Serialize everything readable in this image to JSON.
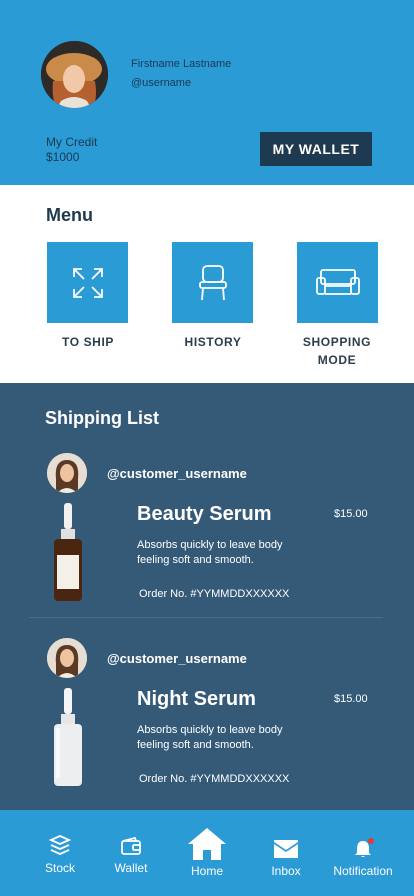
{
  "profile": {
    "name": "Firstname Lastname",
    "handle": "@username",
    "credit_label": "My Credit",
    "credit_value": "$1000",
    "wallet_button": "MY WALLET"
  },
  "menu": {
    "title": "Menu",
    "items": [
      {
        "label": "TO SHIP",
        "icon": "expand-arrows-icon"
      },
      {
        "label": "HISTORY",
        "icon": "chair-icon"
      },
      {
        "label": "SHOPPING",
        "label2": "MODE",
        "icon": "sofa-icon"
      }
    ]
  },
  "shipping": {
    "title": "Shipping List",
    "orders": [
      {
        "customer": "@customer_username",
        "product": "Beauty Serum",
        "price": "$15.00",
        "description": "Absorbs quickly to leave body feeling soft and smooth.",
        "order_no": "Order No. #YYMMDDXXXXXX"
      },
      {
        "customer": "@customer_username",
        "product": "Night Serum",
        "price": "$15.00",
        "description": "Absorbs quickly to leave body feeling soft and smooth.",
        "order_no": "Order No. #YYMMDDXXXXXX"
      }
    ]
  },
  "nav": {
    "items": [
      {
        "label": "Stock",
        "icon": "layers-icon"
      },
      {
        "label": "Wallet",
        "icon": "wallet-icon"
      },
      {
        "label": "Home",
        "icon": "home-icon"
      },
      {
        "label": "Inbox",
        "icon": "envelope-icon"
      },
      {
        "label": "Notification",
        "icon": "bell-icon"
      }
    ]
  },
  "colors": {
    "primary": "#2b9bd6",
    "dark": "#1e3a50",
    "panel": "#355a78",
    "badge": "#e53935"
  }
}
